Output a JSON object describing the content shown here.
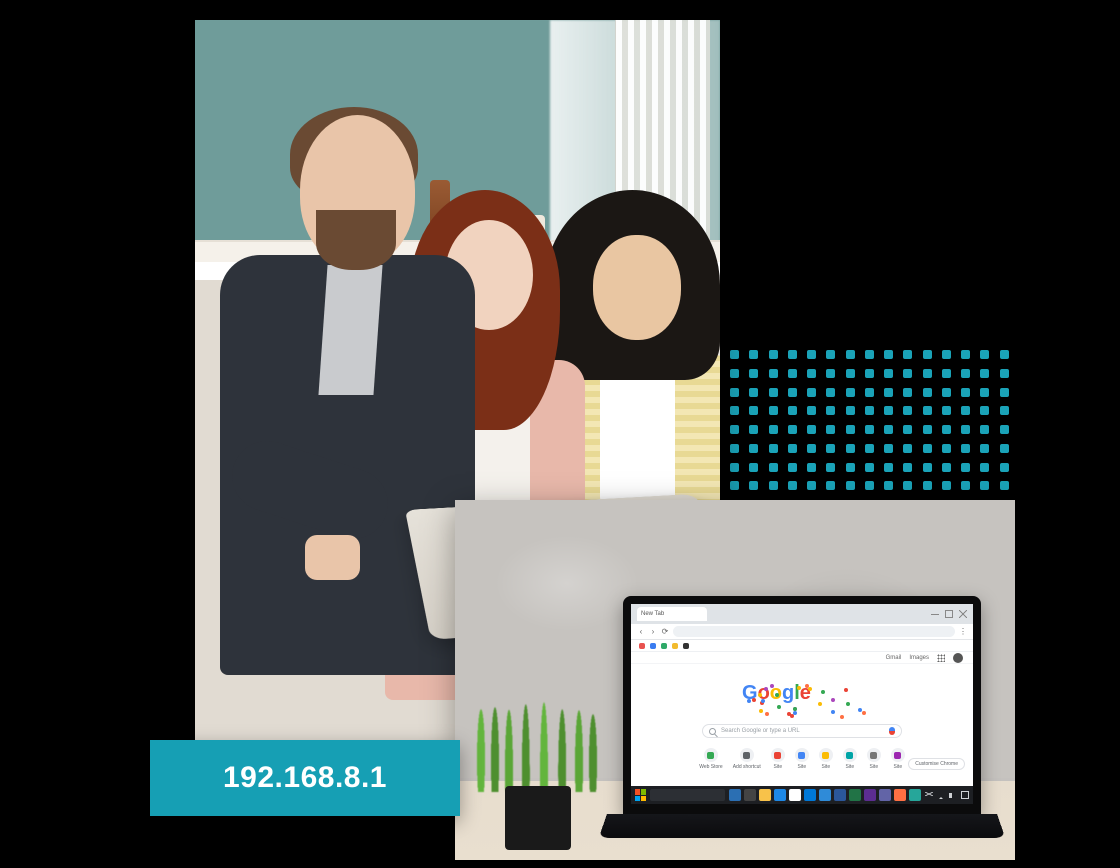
{
  "badge": {
    "ip": "192.168.8.1"
  },
  "accent": {
    "teal": "#169fb4"
  },
  "browser": {
    "tab_title": "New Tab",
    "toolbar": {
      "gmail": "Gmail",
      "images": "Images"
    },
    "logo_letters": [
      "G",
      "o",
      "o",
      "g",
      "l",
      "e"
    ],
    "search_placeholder": "Search Google or type a URL",
    "customise_label": "Customise Chrome",
    "shortcuts": [
      {
        "label": "Web Store",
        "color": "#34a853"
      },
      {
        "label": "Add shortcut",
        "color": "#5f6368"
      },
      {
        "label": "Site",
        "color": "#ea4335"
      },
      {
        "label": "Site",
        "color": "#4285f4"
      },
      {
        "label": "Site",
        "color": "#fbbc05"
      },
      {
        "label": "Site",
        "color": "#00a4a6"
      },
      {
        "label": "Site",
        "color": "#777777"
      },
      {
        "label": "Site",
        "color": "#9c27b0"
      }
    ]
  },
  "taskbar": {
    "apps": [
      {
        "name": "cortana",
        "color": "#2b6fb3"
      },
      {
        "name": "task-view",
        "color": "#444"
      },
      {
        "name": "explorer",
        "color": "#f8c24a"
      },
      {
        "name": "edge",
        "color": "#1e88e5"
      },
      {
        "name": "chrome",
        "color": "#ffffff"
      },
      {
        "name": "store",
        "color": "#0078d7"
      },
      {
        "name": "mail",
        "color": "#2f8bd8"
      },
      {
        "name": "word",
        "color": "#2b579a"
      },
      {
        "name": "excel",
        "color": "#217346"
      },
      {
        "name": "vs",
        "color": "#5c2d91"
      },
      {
        "name": "teams",
        "color": "#6264a7"
      },
      {
        "name": "app",
        "color": "#ff7043"
      },
      {
        "name": "app",
        "color": "#26a69a"
      }
    ]
  }
}
